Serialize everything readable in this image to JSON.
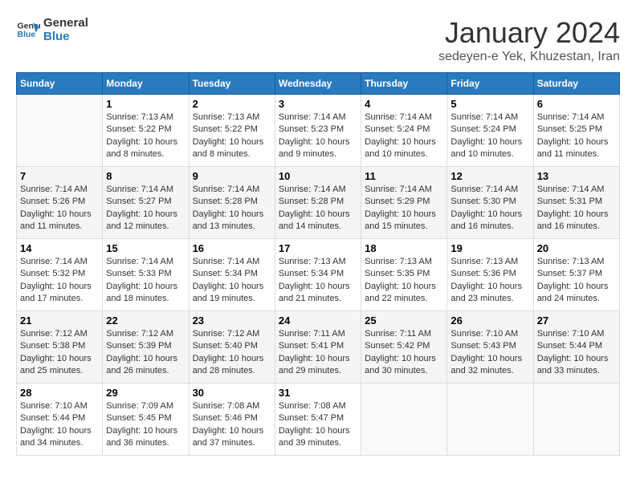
{
  "logo": {
    "line1": "General",
    "line2": "Blue"
  },
  "title": "January 2024",
  "subtitle": "sedeyen-e Yek, Khuzestan, Iran",
  "days_of_week": [
    "Sunday",
    "Monday",
    "Tuesday",
    "Wednesday",
    "Thursday",
    "Friday",
    "Saturday"
  ],
  "weeks": [
    [
      {
        "day": "",
        "info": ""
      },
      {
        "day": "1",
        "info": "Sunrise: 7:13 AM\nSunset: 5:22 PM\nDaylight: 10 hours\nand 8 minutes."
      },
      {
        "day": "2",
        "info": "Sunrise: 7:13 AM\nSunset: 5:22 PM\nDaylight: 10 hours\nand 8 minutes."
      },
      {
        "day": "3",
        "info": "Sunrise: 7:14 AM\nSunset: 5:23 PM\nDaylight: 10 hours\nand 9 minutes."
      },
      {
        "day": "4",
        "info": "Sunrise: 7:14 AM\nSunset: 5:24 PM\nDaylight: 10 hours\nand 10 minutes."
      },
      {
        "day": "5",
        "info": "Sunrise: 7:14 AM\nSunset: 5:24 PM\nDaylight: 10 hours\nand 10 minutes."
      },
      {
        "day": "6",
        "info": "Sunrise: 7:14 AM\nSunset: 5:25 PM\nDaylight: 10 hours\nand 11 minutes."
      }
    ],
    [
      {
        "day": "7",
        "info": "Sunrise: 7:14 AM\nSunset: 5:26 PM\nDaylight: 10 hours\nand 11 minutes."
      },
      {
        "day": "8",
        "info": "Sunrise: 7:14 AM\nSunset: 5:27 PM\nDaylight: 10 hours\nand 12 minutes."
      },
      {
        "day": "9",
        "info": "Sunrise: 7:14 AM\nSunset: 5:28 PM\nDaylight: 10 hours\nand 13 minutes."
      },
      {
        "day": "10",
        "info": "Sunrise: 7:14 AM\nSunset: 5:28 PM\nDaylight: 10 hours\nand 14 minutes."
      },
      {
        "day": "11",
        "info": "Sunrise: 7:14 AM\nSunset: 5:29 PM\nDaylight: 10 hours\nand 15 minutes."
      },
      {
        "day": "12",
        "info": "Sunrise: 7:14 AM\nSunset: 5:30 PM\nDaylight: 10 hours\nand 16 minutes."
      },
      {
        "day": "13",
        "info": "Sunrise: 7:14 AM\nSunset: 5:31 PM\nDaylight: 10 hours\nand 16 minutes."
      }
    ],
    [
      {
        "day": "14",
        "info": "Sunrise: 7:14 AM\nSunset: 5:32 PM\nDaylight: 10 hours\nand 17 minutes."
      },
      {
        "day": "15",
        "info": "Sunrise: 7:14 AM\nSunset: 5:33 PM\nDaylight: 10 hours\nand 18 minutes."
      },
      {
        "day": "16",
        "info": "Sunrise: 7:14 AM\nSunset: 5:34 PM\nDaylight: 10 hours\nand 19 minutes."
      },
      {
        "day": "17",
        "info": "Sunrise: 7:13 AM\nSunset: 5:34 PM\nDaylight: 10 hours\nand 21 minutes."
      },
      {
        "day": "18",
        "info": "Sunrise: 7:13 AM\nSunset: 5:35 PM\nDaylight: 10 hours\nand 22 minutes."
      },
      {
        "day": "19",
        "info": "Sunrise: 7:13 AM\nSunset: 5:36 PM\nDaylight: 10 hours\nand 23 minutes."
      },
      {
        "day": "20",
        "info": "Sunrise: 7:13 AM\nSunset: 5:37 PM\nDaylight: 10 hours\nand 24 minutes."
      }
    ],
    [
      {
        "day": "21",
        "info": "Sunrise: 7:12 AM\nSunset: 5:38 PM\nDaylight: 10 hours\nand 25 minutes."
      },
      {
        "day": "22",
        "info": "Sunrise: 7:12 AM\nSunset: 5:39 PM\nDaylight: 10 hours\nand 26 minutes."
      },
      {
        "day": "23",
        "info": "Sunrise: 7:12 AM\nSunset: 5:40 PM\nDaylight: 10 hours\nand 28 minutes."
      },
      {
        "day": "24",
        "info": "Sunrise: 7:11 AM\nSunset: 5:41 PM\nDaylight: 10 hours\nand 29 minutes."
      },
      {
        "day": "25",
        "info": "Sunrise: 7:11 AM\nSunset: 5:42 PM\nDaylight: 10 hours\nand 30 minutes."
      },
      {
        "day": "26",
        "info": "Sunrise: 7:10 AM\nSunset: 5:43 PM\nDaylight: 10 hours\nand 32 minutes."
      },
      {
        "day": "27",
        "info": "Sunrise: 7:10 AM\nSunset: 5:44 PM\nDaylight: 10 hours\nand 33 minutes."
      }
    ],
    [
      {
        "day": "28",
        "info": "Sunrise: 7:10 AM\nSunset: 5:44 PM\nDaylight: 10 hours\nand 34 minutes."
      },
      {
        "day": "29",
        "info": "Sunrise: 7:09 AM\nSunset: 5:45 PM\nDaylight: 10 hours\nand 36 minutes."
      },
      {
        "day": "30",
        "info": "Sunrise: 7:08 AM\nSunset: 5:46 PM\nDaylight: 10 hours\nand 37 minutes."
      },
      {
        "day": "31",
        "info": "Sunrise: 7:08 AM\nSunset: 5:47 PM\nDaylight: 10 hours\nand 39 minutes."
      },
      {
        "day": "",
        "info": ""
      },
      {
        "day": "",
        "info": ""
      },
      {
        "day": "",
        "info": ""
      }
    ]
  ]
}
